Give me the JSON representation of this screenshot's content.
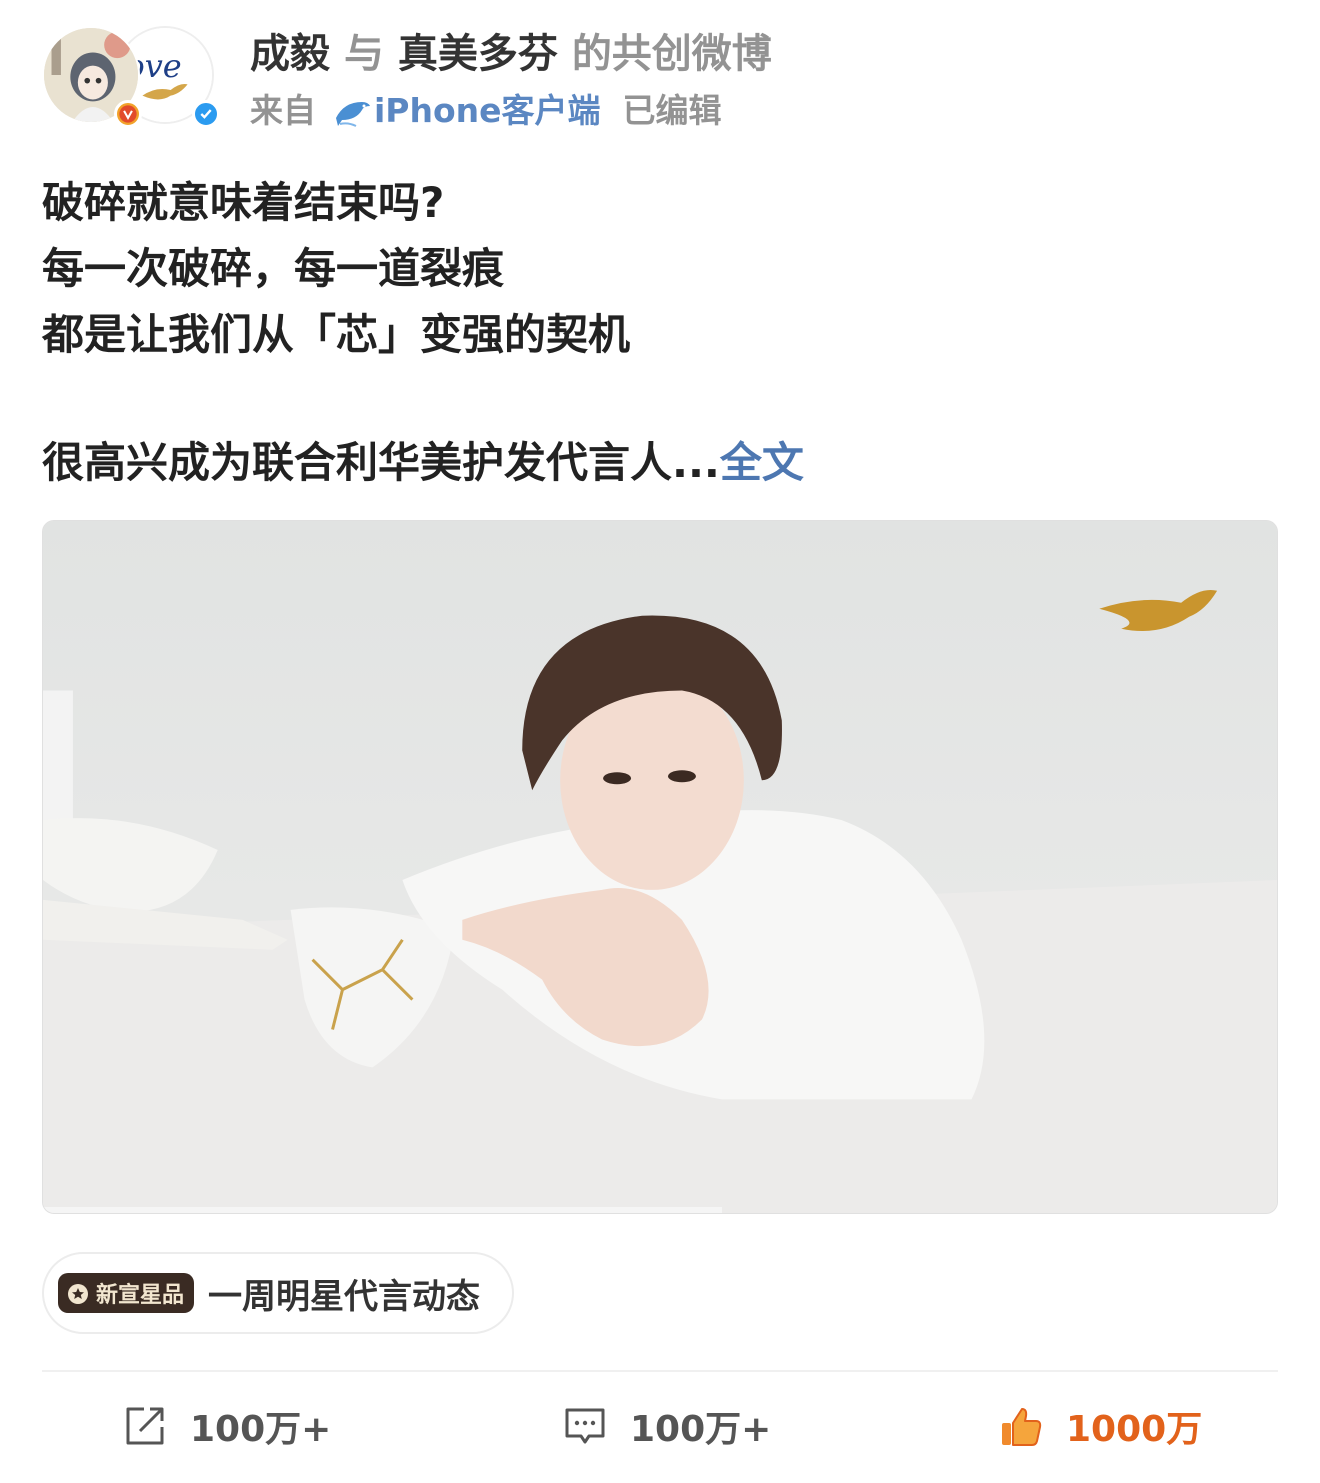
{
  "header": {
    "author": "成毅",
    "connector": "与",
    "coauthor": "真美多芬",
    "suffix": "的共创微博",
    "from_label": "来自",
    "client": "iPhone客户端",
    "edited": "已编辑",
    "avatar2_text": "ove"
  },
  "post": {
    "lines": [
      "破碎就意味着结束吗?",
      "每一次破碎，每一道裂痕",
      "都是让我们从「芯」变强的契机"
    ],
    "last_line": "很高兴成为联合利华美护发代言人...",
    "more": "全文"
  },
  "video": {
    "progress": 0.55,
    "brand_color": "#c9952e"
  },
  "topic": {
    "badge": "新宣星品",
    "text": "一周明星代言动态"
  },
  "actions": {
    "share_count": "100万+",
    "comment_count": "100万+",
    "like_count": "1000万"
  },
  "colors": {
    "link": "#4d77b1",
    "like": "#e2621b",
    "muted": "#939393"
  }
}
